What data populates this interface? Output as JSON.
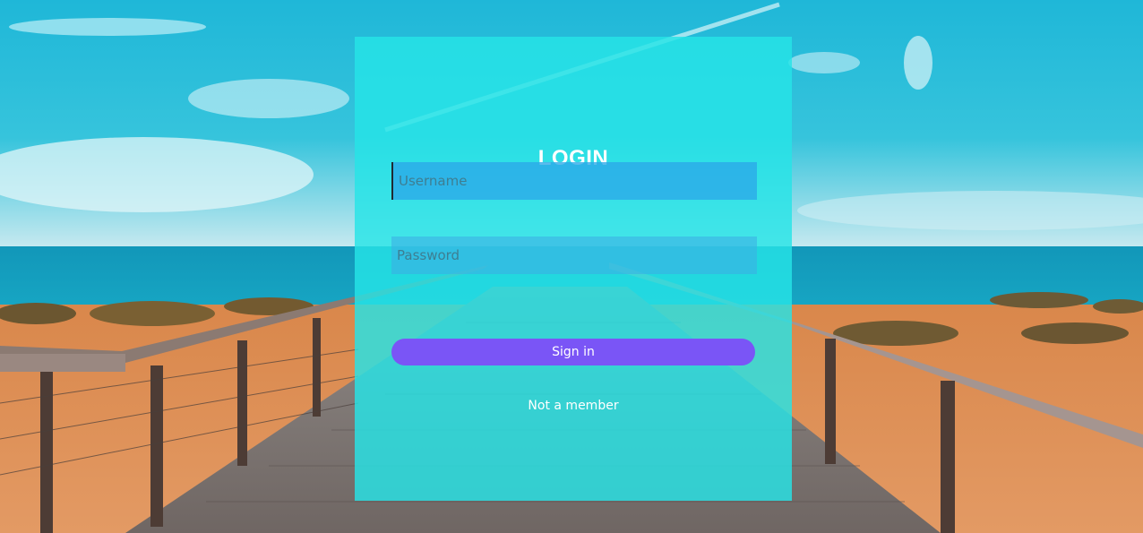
{
  "login": {
    "title": "LOGIN",
    "username_placeholder": "Username",
    "password_placeholder": "Password",
    "signin_label": "Sign in",
    "member_link": "Not a member"
  },
  "colors": {
    "card_overlay": "#26e4e6",
    "button": "#7a55f6",
    "text": "#ffffff"
  }
}
